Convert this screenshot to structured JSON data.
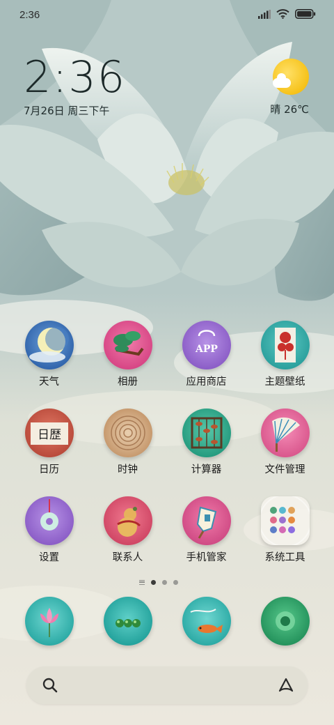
{
  "status_bar": {
    "time": "2:36",
    "icons": [
      "signal-icon",
      "wifi-icon",
      "battery-icon"
    ]
  },
  "clock_widget": {
    "time": "2:36",
    "date": "7月26日 周三下午"
  },
  "weather_widget": {
    "condition_icon": "partly-sunny-icon",
    "text": "晴 26℃"
  },
  "apps": [
    {
      "label": "天气",
      "icon": "moon-icon",
      "color": "#3d72b8"
    },
    {
      "label": "相册",
      "icon": "pine-tree-icon",
      "color": "#e65a92"
    },
    {
      "label": "应用商店",
      "icon": "app-store-icon",
      "color": "#9c6fd0"
    },
    {
      "label": "主题壁纸",
      "icon": "flower-paper-cut-icon",
      "color": "#36a9a6"
    },
    {
      "label": "日历",
      "icon": "calendar-scroll-icon",
      "color": "#c75a47"
    },
    {
      "label": "时钟",
      "icon": "tree-rings-icon",
      "color": "#c89c73"
    },
    {
      "label": "计算器",
      "icon": "abacus-icon",
      "color": "#31a58f"
    },
    {
      "label": "文件管理",
      "icon": "folding-fan-icon",
      "color": "#e46a9c"
    },
    {
      "label": "设置",
      "icon": "jade-disc-icon",
      "color": "#9c6fd0"
    },
    {
      "label": "联系人",
      "icon": "gourd-icon",
      "color": "#e25b7c"
    },
    {
      "label": "手机管家",
      "icon": "shield-tag-icon",
      "color": "#e0528a"
    },
    {
      "label": "系统工具",
      "icon": "tools-folder-icon",
      "color": "#eceae2"
    }
  ],
  "page_indicator": {
    "pages": 3,
    "active": 1
  },
  "dock": [
    {
      "icon": "lotus-icon",
      "color": "#35b9b5"
    },
    {
      "icon": "chat-bubbles-icon",
      "color": "#2eb3ad"
    },
    {
      "icon": "koi-fish-icon",
      "color": "#3ab9b4"
    },
    {
      "icon": "lotus-leaf-icon",
      "color": "#34a86e"
    }
  ],
  "search_bar": {
    "left_icon": "search-icon",
    "right_icon": "assistant-icon"
  }
}
